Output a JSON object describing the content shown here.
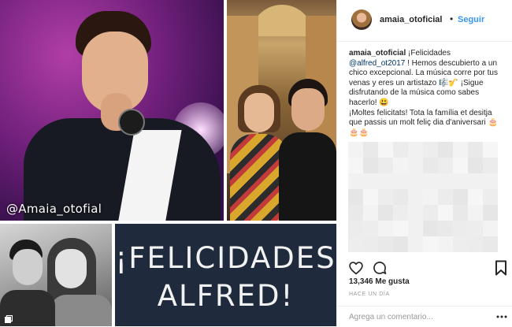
{
  "media": {
    "watermark": "@Amaia_otofial",
    "banner_line1": "¡FELICIDADES",
    "banner_line2": "ALFRED!",
    "collection_icon": "collection-icon"
  },
  "header": {
    "username": "amaia_otoficial",
    "separator": "•",
    "follow_label": "Seguir",
    "avatar_icon": "avatar"
  },
  "caption": {
    "username": "amaia_otoficial",
    "text_before_mention": " ¡Felicidades ",
    "mention": "@alfred_ot2017",
    "text_after_mention": " ! Hemos descubierto a un chico excepcional. La música corre por tus venas y eres un artistazo 🎼🎷 ¡Sigue disfrutando de la música como sabes hacerlo! 😃",
    "paragraph2": "¡Moltes felicitats! Tota la família et desitja que passis un molt feliç dia d'aniversari 🎂🎂🎂"
  },
  "actions": {
    "like_icon": "heart-icon",
    "comment_icon": "comment-icon",
    "save_icon": "bookmark-icon"
  },
  "likes": "13,346 Me gusta",
  "timestamp": "HACE UN DÍA",
  "comment_bar": {
    "placeholder": "Agrega un comentario...",
    "more_icon": "more-options-icon"
  },
  "colors": {
    "link_blue": "#3897f0",
    "mention_blue": "#003569",
    "text": "#262626",
    "muted": "#999999",
    "banner_bg": "#1f2a3c"
  }
}
